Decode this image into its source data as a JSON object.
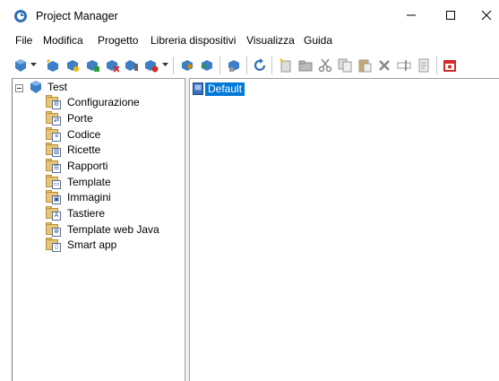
{
  "window": {
    "title": "Project Manager",
    "minimize_glyph": "—",
    "maximize_glyph": "☐",
    "close_glyph": "✕"
  },
  "menu": [
    "File",
    "Modifica",
    "Progetto",
    "Libreria dispositivi",
    "Visualizza",
    "Guida"
  ],
  "toolbar": {
    "icons": [
      "project-icon",
      "new-project-icon",
      "open-project-icon",
      "add-device-icon",
      "remove-device-icon",
      "device-settings-icon",
      "device-dropdown-icon",
      "download-icon",
      "upload-icon",
      "compile-icon",
      "refresh-icon",
      "new-icon",
      "folder-icon",
      "cut-icon",
      "copy-icon",
      "paste-icon",
      "delete-icon",
      "rename-icon",
      "properties-icon",
      "close-project-icon"
    ]
  },
  "tree": {
    "root": "Test",
    "items": [
      {
        "label": "Configurazione",
        "icon": "gear"
      },
      {
        "label": "Porte",
        "icon": "port"
      },
      {
        "label": "Codice",
        "icon": "code"
      },
      {
        "label": "Ricette",
        "icon": "recipe"
      },
      {
        "label": "Rapporti",
        "icon": "report"
      },
      {
        "label": "Template",
        "icon": "template"
      },
      {
        "label": "Immagini",
        "icon": "image"
      },
      {
        "label": "Tastiere",
        "icon": "keyboard"
      },
      {
        "label": "Template web Java",
        "icon": "web"
      },
      {
        "label": "Smart app",
        "icon": "smart"
      }
    ]
  },
  "detail": {
    "selected_item": "Default"
  },
  "colors": {
    "selection": "#0078d7",
    "folder": "#e7c57a"
  }
}
